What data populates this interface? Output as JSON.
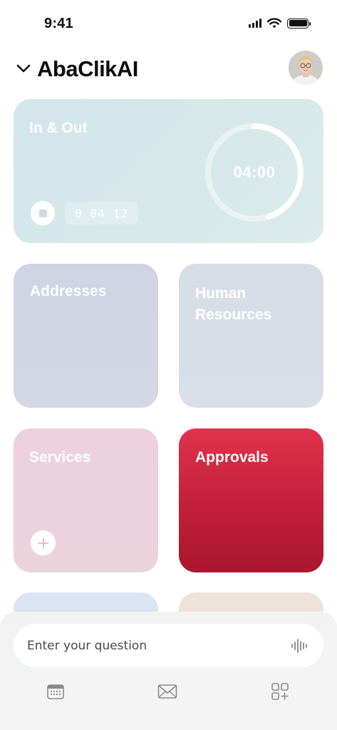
{
  "status_bar": {
    "time": "9:41"
  },
  "header": {
    "app_title": "AbaClikAI"
  },
  "cards": {
    "in_out": {
      "title": "In & Out",
      "timer": "04:00",
      "elapsed": "0 04 12",
      "progress": 0.45
    },
    "addresses": {
      "title": "Addresses"
    },
    "human_resources": {
      "title": "Human\nResources"
    },
    "services": {
      "title": "Services"
    },
    "approvals": {
      "title": "Approvals"
    }
  },
  "ask": {
    "placeholder": "Enter your question"
  },
  "tabs": [
    "calendar-icon",
    "mail-icon",
    "add-widget-icon"
  ],
  "colors": {
    "approvals": "#c11f3a",
    "in_out": "#d3e6eb"
  }
}
